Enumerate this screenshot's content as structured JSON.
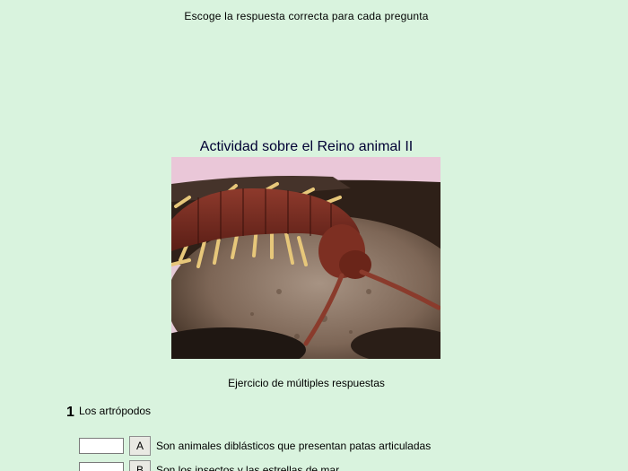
{
  "instruction": "Escoge la respuesta correcta para cada pregunta",
  "activity_title": "Actividad sobre el Reino animal II",
  "exercise_type": "Ejercicio de múltiples respuestas",
  "questions": [
    {
      "number": "1",
      "text": "Los artrópodos",
      "options": [
        {
          "letter": "A",
          "text": "Son animales diblásticos que presentan patas articuladas",
          "value": ""
        },
        {
          "letter": "B",
          "text": "Son los insectos y las estrellas de mar",
          "value": ""
        }
      ]
    }
  ],
  "colors": {
    "background": "#d9f3de",
    "title": "#000033"
  },
  "image": {
    "semantic": "centipede-photo"
  }
}
